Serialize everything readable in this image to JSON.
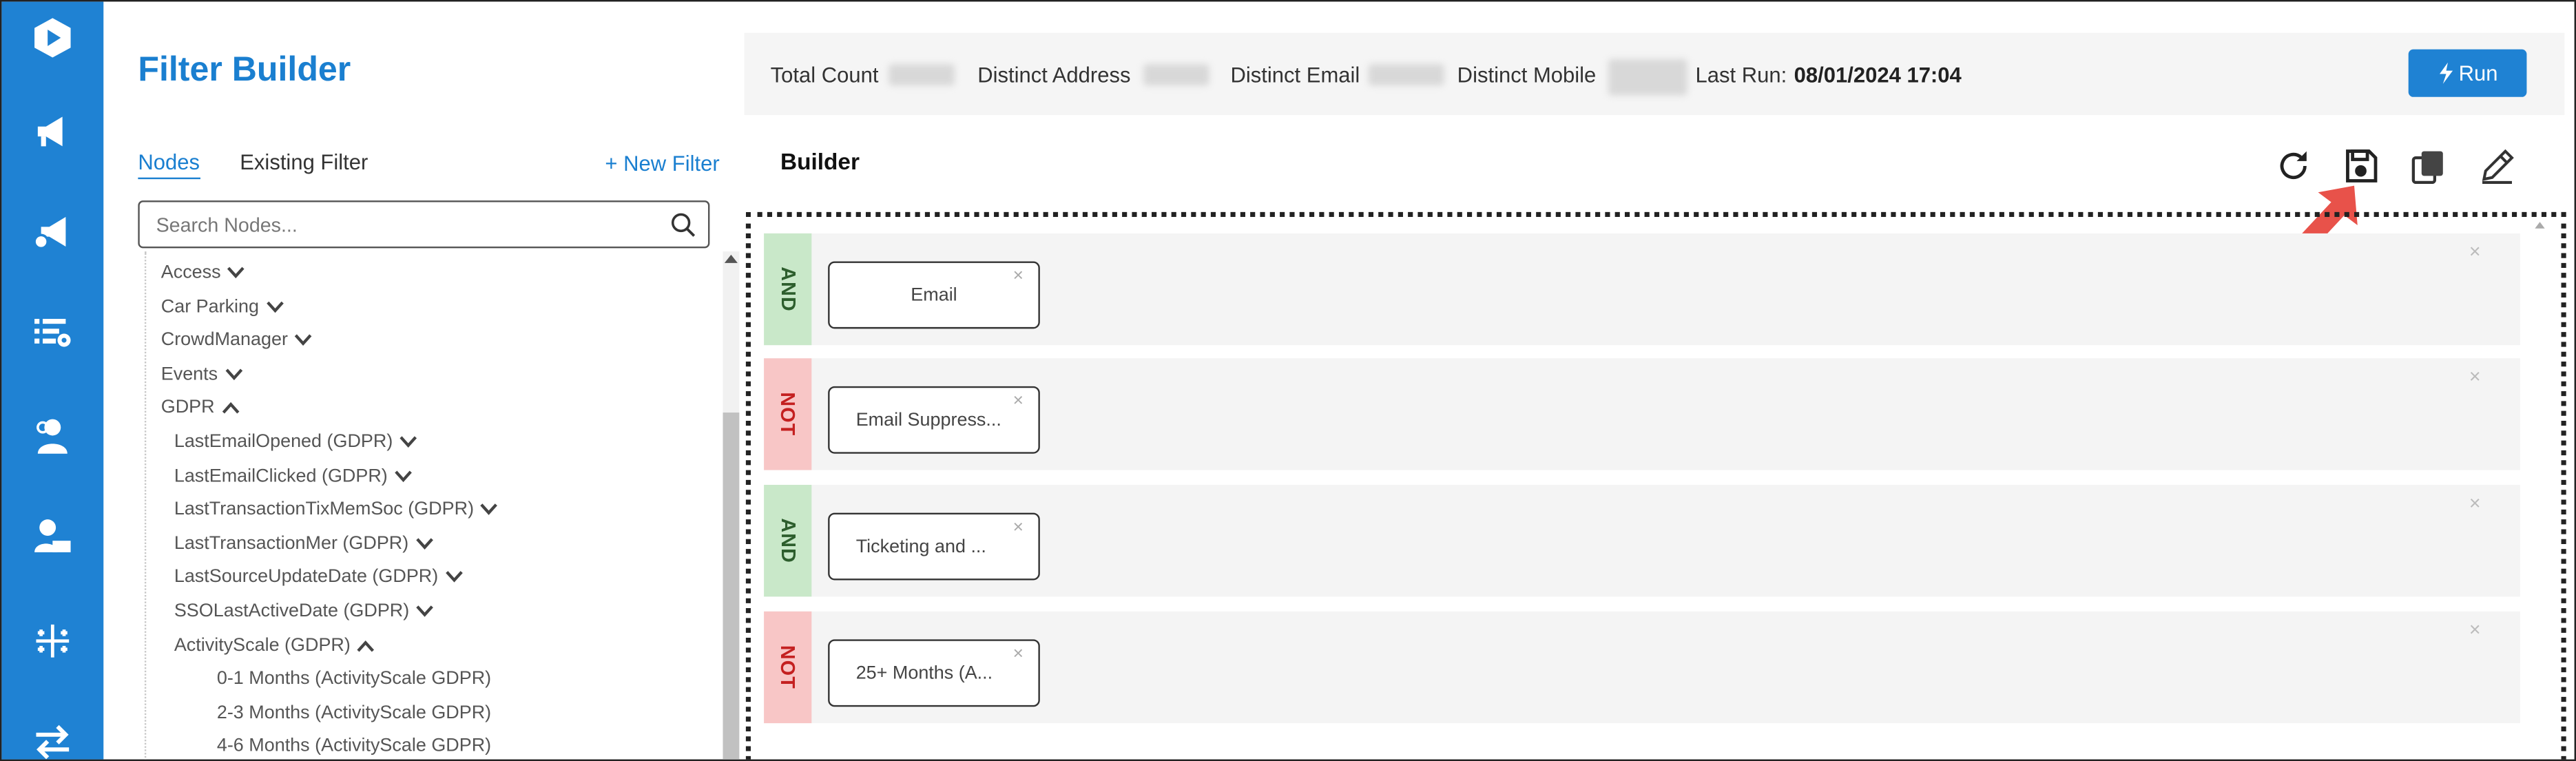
{
  "app": {
    "title": "Filter Builder"
  },
  "rail": {
    "items": [
      {
        "icon": "logo-icon"
      },
      {
        "icon": "megaphone-icon"
      },
      {
        "icon": "megaphone-settings-icon"
      },
      {
        "icon": "list-settings-icon"
      },
      {
        "icon": "person-settings-icon"
      },
      {
        "icon": "person-laptop-icon"
      },
      {
        "icon": "tableau-icon"
      },
      {
        "icon": "transfer-icon"
      }
    ]
  },
  "left_panel": {
    "tabs": [
      "Nodes",
      "Existing Filter"
    ],
    "active_tab": "Nodes",
    "new_filter_label": "+ New Filter",
    "search_placeholder": "Search Nodes...",
    "tree": [
      {
        "label": "Access",
        "chevron": "down"
      },
      {
        "label": "Car Parking",
        "chevron": "down"
      },
      {
        "label": "CrowdManager",
        "chevron": "down"
      },
      {
        "label": "Events",
        "chevron": "down"
      },
      {
        "label": "GDPR",
        "chevron": "up"
      },
      {
        "label": "LastEmailOpened (GDPR)",
        "chevron": "down"
      },
      {
        "label": "LastEmailClicked (GDPR)",
        "chevron": "down"
      },
      {
        "label": "LastTransactionTixMemSoc (GDPR)",
        "chevron": "down"
      },
      {
        "label": "LastTransactionMer (GDPR)",
        "chevron": "down"
      },
      {
        "label": "LastSourceUpdateDate (GDPR)",
        "chevron": "down"
      },
      {
        "label": "SSOLastActiveDate (GDPR)",
        "chevron": "down"
      },
      {
        "label": "ActivityScale (GDPR)",
        "chevron": "up"
      },
      {
        "label": "0-1 Months (ActivityScale GDPR)",
        "chevron": ""
      },
      {
        "label": "2-3 Months (ActivityScale GDPR)",
        "chevron": ""
      },
      {
        "label": "4-6 Months (ActivityScale GDPR)",
        "chevron": ""
      }
    ]
  },
  "stats": {
    "total_count_label": "Total Count",
    "distinct_address_label": "Distinct Address",
    "distinct_email_label": "Distinct Email",
    "distinct_mobile_label": "Distinct Mobile",
    "last_run_label": "Last Run:",
    "last_run_value": "08/01/2024 17:04",
    "run_button_label": "Run"
  },
  "builder": {
    "title": "Builder",
    "tools": [
      "refresh-icon",
      "save-icon",
      "copy-icon",
      "edit-icon"
    ],
    "rows": [
      {
        "operator": "AND",
        "chip": "Email"
      },
      {
        "operator": "NOT",
        "chip": "Email Suppress..."
      },
      {
        "operator": "AND",
        "chip": "Ticketing and ..."
      },
      {
        "operator": "NOT",
        "chip": "25+ Months (A..."
      }
    ],
    "close_glyph": "×"
  },
  "colors": {
    "brand_blue": "#1f82d3",
    "and_bg": "#c9e8c9",
    "not_bg": "#f8c6c6",
    "not_text": "#c42020",
    "arrow": "#e8524a"
  }
}
